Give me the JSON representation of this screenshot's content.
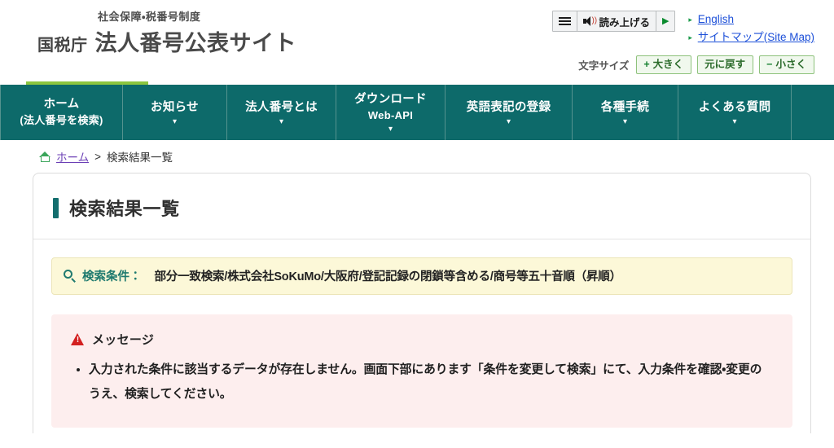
{
  "header": {
    "brand_sub": "社会保障・税番号制度",
    "brand_agency": "国税庁",
    "brand_title": "法人番号公表サイト",
    "readaloud": {
      "menu_icon": "hamburger-icon",
      "speaker_icon": "speaker-icon",
      "label": "読み上げる",
      "play_icon": "play-icon"
    },
    "links": [
      {
        "label": "English"
      },
      {
        "label": "サイトマップ(Site Map)"
      }
    ],
    "fontsize": {
      "label": "文字サイズ",
      "buttons": [
        {
          "sign": "+",
          "label": "大きく"
        },
        {
          "sign": "",
          "label": "元に戻す"
        },
        {
          "sign": "−",
          "label": "小さく"
        }
      ]
    }
  },
  "nav": {
    "accent_color": "#8cc63f",
    "bar_color": "#0d6a6a",
    "items": [
      {
        "label": "ホーム",
        "sub": "(法人番号を検索)",
        "caret": false,
        "active": true
      },
      {
        "label": "お知らせ",
        "sub": "",
        "caret": true,
        "active": false
      },
      {
        "label": "法人番号とは",
        "sub": "",
        "caret": true,
        "active": false
      },
      {
        "label": "ダウンロード",
        "sub": "Web-API",
        "caret": true,
        "active": false
      },
      {
        "label": "英語表記の登録",
        "sub": "",
        "caret": true,
        "active": false
      },
      {
        "label": "各種手続",
        "sub": "",
        "caret": true,
        "active": false
      },
      {
        "label": "よくある質問",
        "sub": "",
        "caret": true,
        "active": false
      }
    ]
  },
  "breadcrumb": {
    "home_icon": "home-icon",
    "home_label": "ホーム",
    "separator": ">",
    "current": "検索結果一覧"
  },
  "main": {
    "page_title": "検索結果一覧",
    "condition": {
      "icon": "search-icon",
      "label": "検索条件：",
      "value": "部分一致検索/株式会社SoKuMo/大阪府/登記記録の閉鎖等含める/商号等五十音順（昇順）"
    },
    "message": {
      "icon": "warning-icon",
      "title": "メッセージ",
      "items": [
        "入力された条件に該当するデータが存在しません。画面下部にあります「条件を変更して検索」にて、入力条件を確認・変更のうえ、検索してください。"
      ]
    }
  }
}
